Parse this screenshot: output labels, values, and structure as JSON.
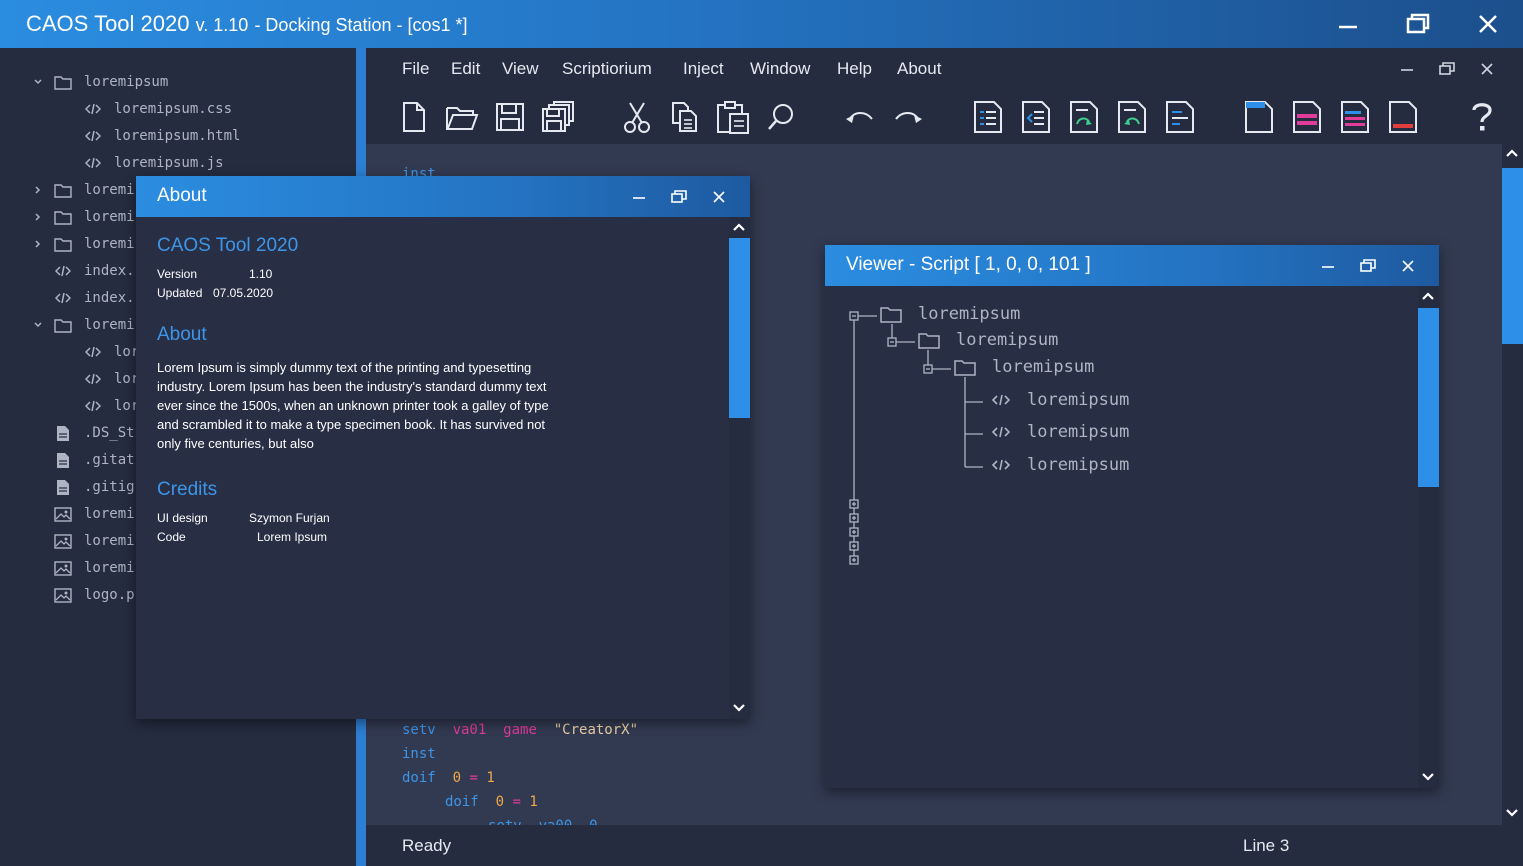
{
  "window": {
    "title": "CAOS Tool 2020",
    "version": "v. 1.10",
    "subtitle": "- Docking Station - [cos1 *]"
  },
  "sidebar": {
    "items": [
      {
        "label": "loremipsum",
        "type": "folder",
        "expanded": true
      },
      {
        "label": "loremipsum.css",
        "type": "code"
      },
      {
        "label": "loremipsum.html",
        "type": "code"
      },
      {
        "label": "loremipsum.js",
        "type": "code"
      },
      {
        "label": "loremi",
        "type": "folder",
        "expanded": false
      },
      {
        "label": "loremi",
        "type": "folder",
        "expanded": false
      },
      {
        "label": "loremi",
        "type": "folder",
        "expanded": false
      },
      {
        "label": "index.",
        "type": "code"
      },
      {
        "label": "index.",
        "type": "code"
      },
      {
        "label": "loremi",
        "type": "folder",
        "expanded": true
      },
      {
        "label": "lor",
        "type": "code"
      },
      {
        "label": "lor",
        "type": "code"
      },
      {
        "label": "lor",
        "type": "code"
      },
      {
        "label": ".DS_St",
        "type": "file"
      },
      {
        "label": ".gitat",
        "type": "file"
      },
      {
        "label": ".gitig",
        "type": "file"
      },
      {
        "label": "loremi",
        "type": "image"
      },
      {
        "label": "loremi",
        "type": "image"
      },
      {
        "label": "loremi",
        "type": "image"
      },
      {
        "label": "logo.p",
        "type": "image"
      }
    ]
  },
  "menu": {
    "items": [
      "File",
      "Edit",
      "View",
      "Scriptiorium",
      "Inject",
      "Window",
      "Help",
      "About"
    ]
  },
  "toolbar": {
    "icons": [
      "new-file-icon",
      "open-folder-icon",
      "save-icon",
      "save-all-icon",
      "cut-icon",
      "copy-icon",
      "paste-icon",
      "search-icon",
      "undo-icon",
      "redo-icon",
      "doc-list-blue-icon",
      "doc-indent-blue-icon",
      "doc-redo-green-icon",
      "doc-undo-green-icon",
      "doc-lines-blue-icon",
      "page-blue-icon",
      "page-pink-icon",
      "page-lines-multicolor-icon",
      "page-red-icon",
      "help-icon"
    ]
  },
  "editor": {
    "hidden_top": "inst",
    "lines": {
      "l1": {
        "kw": "setv",
        "var": "va01",
        "kw2": "game",
        "str": "\"CreatorX\""
      },
      "l2": {
        "kw": "inst"
      },
      "l3": {
        "kw": "doif",
        "num1": "0",
        "op": "=",
        "num2": "1"
      },
      "l4": {
        "kw": "doif",
        "num1": "0",
        "op": "=",
        "num2": "1"
      },
      "l5": {
        "partial": "setv  va00  0"
      }
    }
  },
  "status": {
    "left": "Ready",
    "right": "Line 3"
  },
  "about_dialog": {
    "title": "About",
    "app_name": "CAOS Tool 2020",
    "version_label": "Version",
    "version_value": "1.10",
    "updated_label": "Updated",
    "updated_value": "07.05.2020",
    "about_heading": "About",
    "about_text": "Lorem Ipsum is simply dummy text of the printing and typesetting industry. Lorem Ipsum has been the industry's standard dummy text ever since the 1500s, when an unknown printer took a galley of type and scrambled it to make a type specimen book. It has survived not only five centuries, but also",
    "credits_heading": "Credits",
    "ui_design_label": "UI design",
    "ui_design_value": "Szymon Furjan",
    "code_label": "Code",
    "code_value": "Lorem Ipsum"
  },
  "viewer_dialog": {
    "title": "Viewer - Script [ 1, 0, 0, 101 ]",
    "tree": [
      {
        "label": "loremipsum",
        "type": "folder",
        "depth": 0
      },
      {
        "label": "loremipsum",
        "type": "folder",
        "depth": 1
      },
      {
        "label": "loremipsum",
        "type": "folder",
        "depth": 2
      },
      {
        "label": "loremipsum",
        "type": "code",
        "depth": 3
      },
      {
        "label": "loremipsum",
        "type": "code",
        "depth": 3
      },
      {
        "label": "loremipsum",
        "type": "code",
        "depth": 3
      }
    ]
  },
  "colors": {
    "accent": "#2d8fe8",
    "background": "#252c3f",
    "editor_bg": "#323a52",
    "keyword": "#3d95e8",
    "variable": "#e23c9b",
    "string": "#f0d2a8",
    "number": "#f0a64a"
  }
}
